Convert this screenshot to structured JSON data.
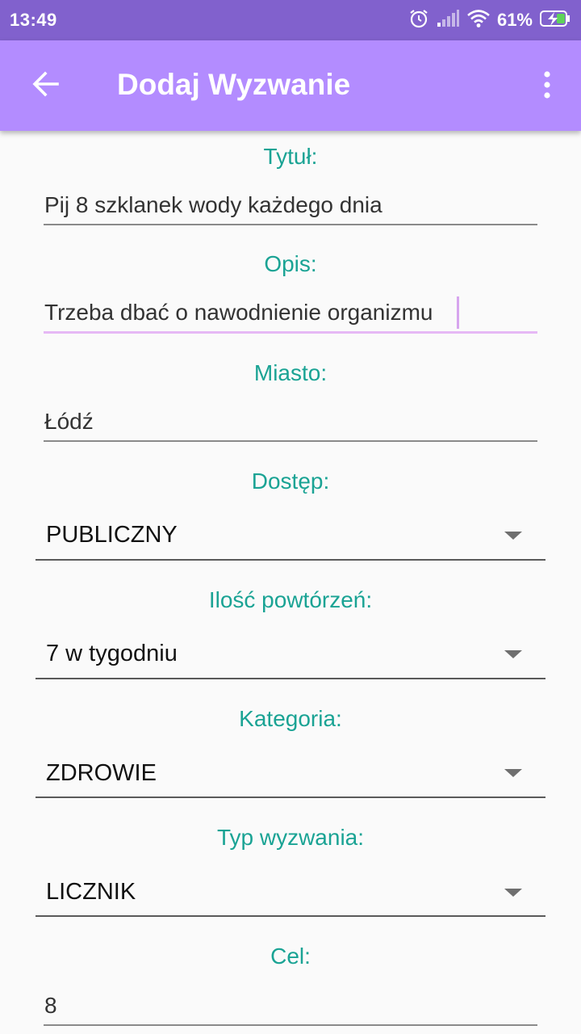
{
  "status_bar": {
    "time": "13:49",
    "battery": "61%",
    "icons": [
      "alarm-icon",
      "signal-icon",
      "wifi-icon",
      "battery-charging-icon"
    ]
  },
  "app_bar": {
    "title": "Dodaj Wyzwanie",
    "back_icon": "arrow-back-icon",
    "menu_icon": "more-vert-icon"
  },
  "form": {
    "title_label": "Tytuł:",
    "title_value": "Pij 8 szklanek wody każdego dnia",
    "description_label": "Opis:",
    "description_value": "Trzeba dbać o nawodnienie organizmu",
    "city_label": "Miasto:",
    "city_value": "Łódź",
    "access_label": "Dostęp:",
    "access_value": "PUBLICZNY",
    "repeats_label": "Ilość powtórzeń:",
    "repeats_value": "7 w tygodniu",
    "category_label": "Kategoria:",
    "category_value": "ZDROWIE",
    "type_label": "Typ wyzwania:",
    "type_value": "LICZNIK",
    "goal_label": "Cel:",
    "goal_value": "8"
  },
  "colors": {
    "status_bar": "#8161cd",
    "app_bar": "#b38cff",
    "label": "#1aa394",
    "focus": "#e6b8f5"
  }
}
